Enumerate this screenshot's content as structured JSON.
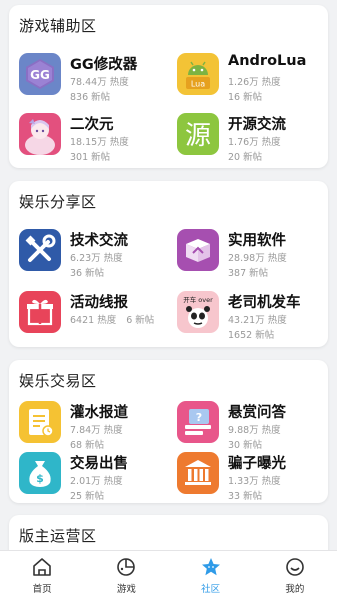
{
  "sections": [
    {
      "title": "游戏辅助区",
      "items": [
        {
          "name": "GG修改器",
          "heat": "78.44万 热度",
          "posts": "836 新帖",
          "icon": "gg-modifier-icon"
        },
        {
          "name": "AndroLua",
          "heat": "1.26万 热度",
          "posts": "16 新帖",
          "icon": "androlua-icon"
        },
        {
          "name": "二次元",
          "heat": "18.15万 热度",
          "posts": "301 新帖",
          "icon": "anime-girl-icon"
        },
        {
          "name": "开源交流",
          "heat": "1.76万 热度",
          "posts": "20 新帖",
          "icon": "source-char-icon",
          "glyph": "源"
        }
      ]
    },
    {
      "title": "娱乐分享区",
      "items": [
        {
          "name": "技术交流",
          "heat": "6.23万 热度",
          "posts": "36 新帖",
          "icon": "tools-icon"
        },
        {
          "name": "实用软件",
          "heat": "28.98万 热度",
          "posts": "387 新帖",
          "icon": "box-icon"
        },
        {
          "name": "活动线报",
          "heat": "6421 热度",
          "posts": "6 新帖",
          "icon": "gift-icon"
        },
        {
          "name": "老司机发车",
          "heat": "43.21万 热度",
          "posts": "1652 新帖",
          "icon": "panda-meme-icon",
          "meme_text": "开车 over"
        }
      ]
    },
    {
      "title": "娱乐交易区",
      "items": [
        {
          "name": "灌水报道",
          "heat": "7.84万 热度",
          "posts": "68 新帖",
          "icon": "notepad-icon"
        },
        {
          "name": "悬赏问答",
          "heat": "9.88万 热度",
          "posts": "30 新帖",
          "icon": "question-icon"
        },
        {
          "name": "交易出售",
          "heat": "2.01万 热度",
          "posts": "25 新帖",
          "icon": "money-bag-icon"
        },
        {
          "name": "骗子曝光",
          "heat": "1.33万 热度",
          "posts": "33 新帖",
          "icon": "bank-icon"
        }
      ]
    },
    {
      "title": "版主运营区",
      "items": []
    }
  ],
  "nav": [
    {
      "label": "首页",
      "icon": "home-icon",
      "active": false
    },
    {
      "label": "游戏",
      "icon": "game-icon",
      "active": false
    },
    {
      "label": "社区",
      "icon": "star-icon",
      "active": true
    },
    {
      "label": "我的",
      "icon": "smile-icon",
      "active": false
    }
  ],
  "colors": {
    "accent": "#2f9be8",
    "background": "#f1f2f4",
    "gg_purple": "#6b86c8",
    "androlua_yellow": "#f3c336",
    "anime_pink": "#e3507e",
    "source_green": "#8dc63f",
    "tools_blue": "#2f5aa8",
    "box_purple": "#a64fb0",
    "gift_red": "#e8445a",
    "panda_pink": "#f7c6cd",
    "notepad_yellow": "#f5c233",
    "question_pink": "#e8568a",
    "money_teal": "#2fb6c9",
    "bank_orange": "#ee7a2f"
  }
}
